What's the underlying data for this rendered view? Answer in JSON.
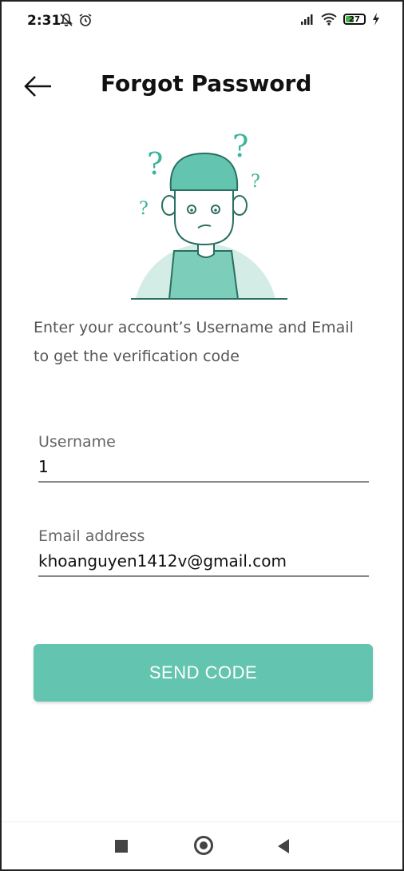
{
  "status_bar": {
    "time": "2:31",
    "battery": "27",
    "icons_left": [
      "notifications-off-icon",
      "alarm-icon"
    ],
    "icons_right": [
      "signal-icon",
      "wifi-icon",
      "battery-icon",
      "charging-icon"
    ]
  },
  "header": {
    "title": "Forgot Password",
    "back_icon": "arrow-left-icon"
  },
  "illustration": {
    "icon": "confused-person-icon",
    "accent_color": "#63c5b0"
  },
  "instructions": {
    "line1": "Enter your account’s Username and Email",
    "line2": "to get the verification code"
  },
  "form": {
    "username_label": "Username",
    "username_value": "1",
    "email_label": "Email address",
    "email_value": "khoanguyen1412v@gmail.com"
  },
  "send_button": {
    "label": "SEND CODE",
    "color": "#63c5b0"
  },
  "nav_bar": {
    "icons": [
      "recents-icon",
      "home-icon",
      "back-icon"
    ]
  }
}
